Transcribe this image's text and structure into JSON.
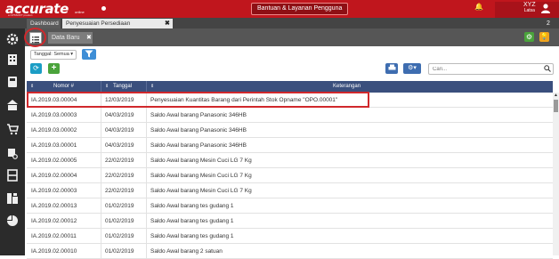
{
  "header": {
    "logo_text": "accurate",
    "logo_suffix": "online",
    "logo_tagline": "a CPSSOFT product",
    "help_label": "Bantuan & Layanan Pengguna",
    "user": {
      "name_line1": "XYZ",
      "name_line2": "Latsa"
    }
  },
  "tabs": [
    {
      "label": "Dashboard"
    },
    {
      "label": "Penyesuaian Persediaan",
      "close": "✖"
    }
  ],
  "tab_counter": "2",
  "subtoolbar": {
    "data_baru_label": "Data Baru",
    "data_baru_close": "✖"
  },
  "filter": {
    "label": "Tanggal: Semua"
  },
  "search": {
    "placeholder": "Cari..."
  },
  "table": {
    "columns": [
      "Nomor #",
      "Tanggal",
      "Keterangan"
    ],
    "rows": [
      {
        "nomor": "IA.2019.03.00004",
        "tanggal": "12/03/2019",
        "keterangan": "Penyesuaian Kuantitas Barang dari Perintah Stok Opname \"OPO.00001\""
      },
      {
        "nomor": "IA.2019.03.00003",
        "tanggal": "04/03/2019",
        "keterangan": "Saldo Awal barang Panasonic 346HB"
      },
      {
        "nomor": "IA.2019.03.00002",
        "tanggal": "04/03/2019",
        "keterangan": "Saldo Awal barang Panasonic 346HB"
      },
      {
        "nomor": "IA.2019.03.00001",
        "tanggal": "04/03/2019",
        "keterangan": "Saldo Awal barang Panasonic 346HB"
      },
      {
        "nomor": "IA.2019.02.00005",
        "tanggal": "22/02/2019",
        "keterangan": "Saldo Awal barang Mesin Cuci LG 7 Kg"
      },
      {
        "nomor": "IA.2019.02.00004",
        "tanggal": "22/02/2019",
        "keterangan": "Saldo Awal barang Mesin Cuci LG 7 Kg"
      },
      {
        "nomor": "IA.2019.02.00003",
        "tanggal": "22/02/2019",
        "keterangan": "Saldo Awal barang Mesin Cuci LG 7 Kg"
      },
      {
        "nomor": "IA.2019.02.00013",
        "tanggal": "01/02/2019",
        "keterangan": "Saldo Awal barang tes gudang 1"
      },
      {
        "nomor": "IA.2019.02.00012",
        "tanggal": "01/02/2019",
        "keterangan": "Saldo Awal barang tes gudang 1"
      },
      {
        "nomor": "IA.2019.02.00011",
        "tanggal": "01/02/2019",
        "keterangan": "Saldo Awal barang tes gudang 1"
      },
      {
        "nomor": "IA.2019.02.00010",
        "tanggal": "01/02/2019",
        "keterangan": "Saldo Awal barang 2 satuan"
      }
    ]
  },
  "colors": {
    "brand_red": "#c0161d",
    "table_header": "#3a4f7d",
    "highlight": "#d0282c"
  }
}
